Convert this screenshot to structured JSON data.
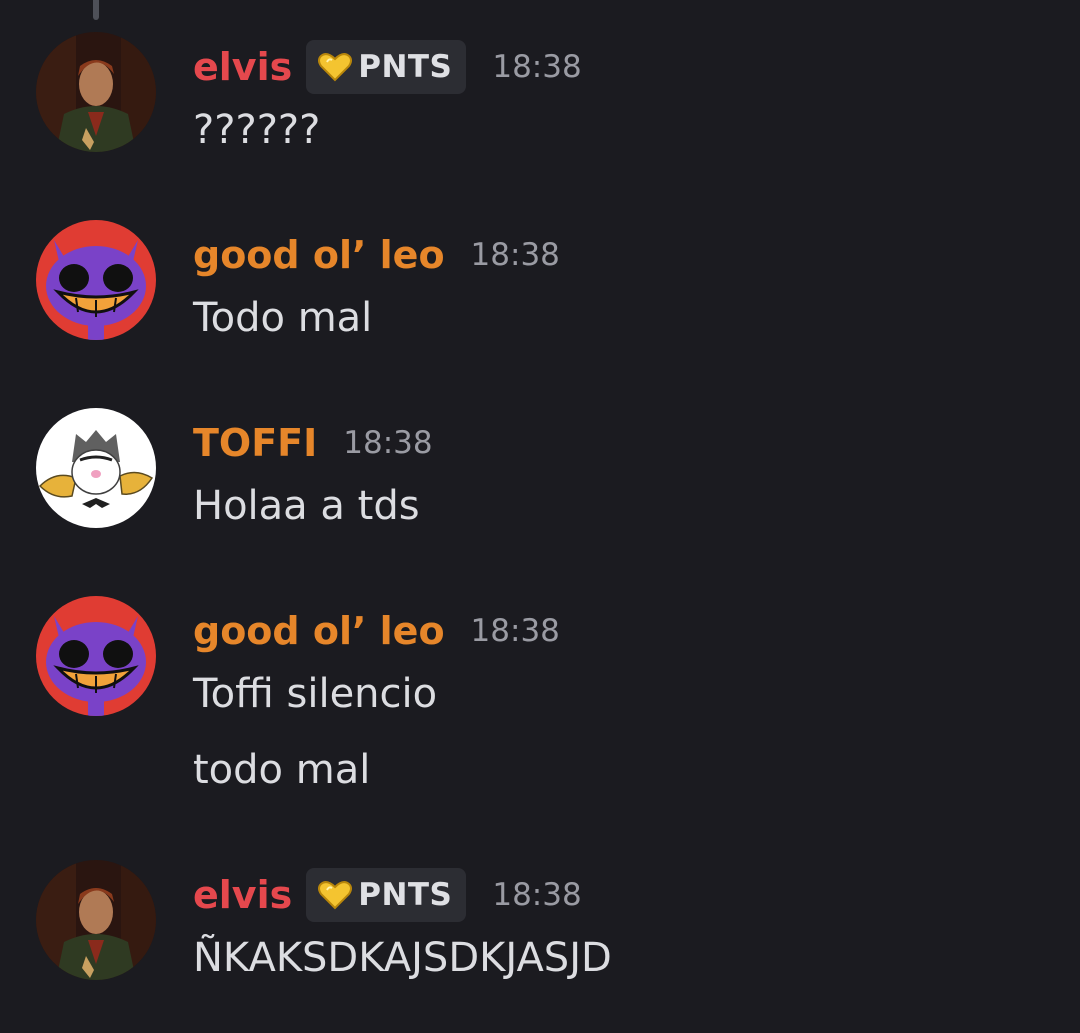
{
  "colors": {
    "background": "#1b1b20",
    "elvis_name": "#e5484d",
    "leo_name": "#e6862a",
    "toffi_name": "#e6862a",
    "message_text": "#dcdde1",
    "timestamp": "#9a9ba3",
    "tag_background": "#2c2d33",
    "tag_heart": "#f4c430"
  },
  "messages": [
    {
      "author": "elvis",
      "avatar_icon": "elvis-avatar-icon",
      "tag": {
        "icon": "heart-icon",
        "label": "PNTS"
      },
      "time": "18:38",
      "lines": [
        "??????"
      ]
    },
    {
      "author": "good ol’ leo",
      "avatar_icon": "jax-avatar-icon",
      "time": "18:38",
      "lines": [
        "Todo mal"
      ]
    },
    {
      "author": "TOFFI",
      "avatar_icon": "toffi-avatar-icon",
      "time": "18:38",
      "lines": [
        "Holaa a tds"
      ]
    },
    {
      "author": "good ol’ leo",
      "avatar_icon": "jax-avatar-icon",
      "time": "18:38",
      "lines": [
        "Toffi silencio",
        "todo mal"
      ]
    },
    {
      "author": "elvis",
      "avatar_icon": "elvis-avatar-icon",
      "tag": {
        "icon": "heart-icon",
        "label": "PNTS"
      },
      "time": "18:38",
      "lines": [
        "ÑKAKSDKAJSDKJASJD"
      ]
    }
  ]
}
